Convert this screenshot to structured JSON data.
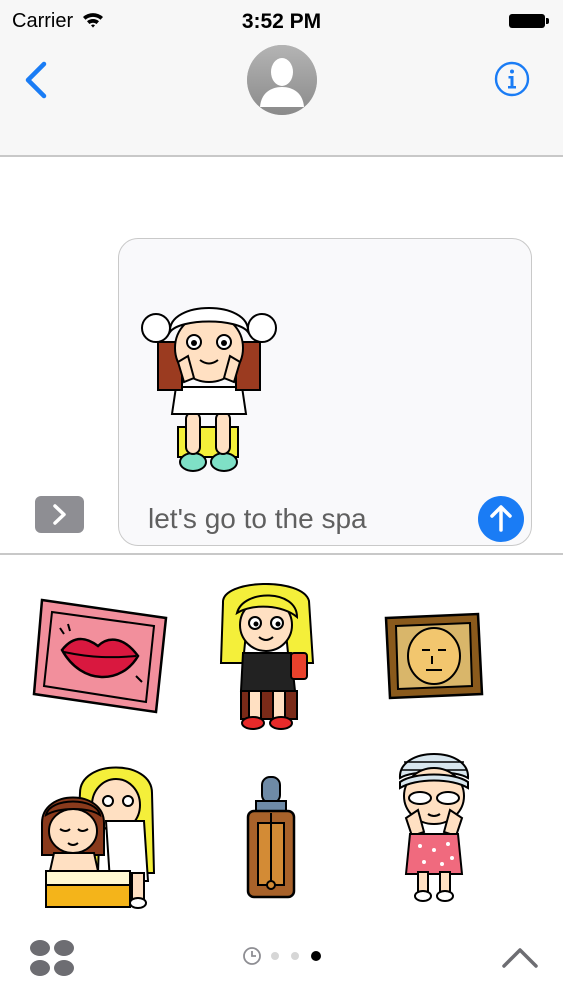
{
  "status_bar": {
    "carrier": "Carrier",
    "time": "3:52 PM"
  },
  "nav": {
    "back_icon": "chevron-left-icon",
    "contact_icon": "person-silhouette-icon",
    "info_icon": "info-circle-icon"
  },
  "compose": {
    "message_text": "let's go to the spa",
    "expand_icon": "chevron-right-icon",
    "send_icon": "arrow-up-icon",
    "attached_sticker": "girl-in-towel-sticker"
  },
  "stickers": [
    "lips-card-sticker",
    "blonde-girl-with-phone-sticker",
    "face-mask-frame-sticker",
    "massage-sticker",
    "serum-bottle-sticker",
    "eye-patches-girl-sticker"
  ],
  "pager": {
    "total_pages": 3,
    "current_page": 3,
    "recent_icon": "clock-icon"
  },
  "colors": {
    "ios_blue": "#1a7cf5",
    "gray_button": "#8e8e93",
    "nav_background": "#f7f7f7"
  }
}
